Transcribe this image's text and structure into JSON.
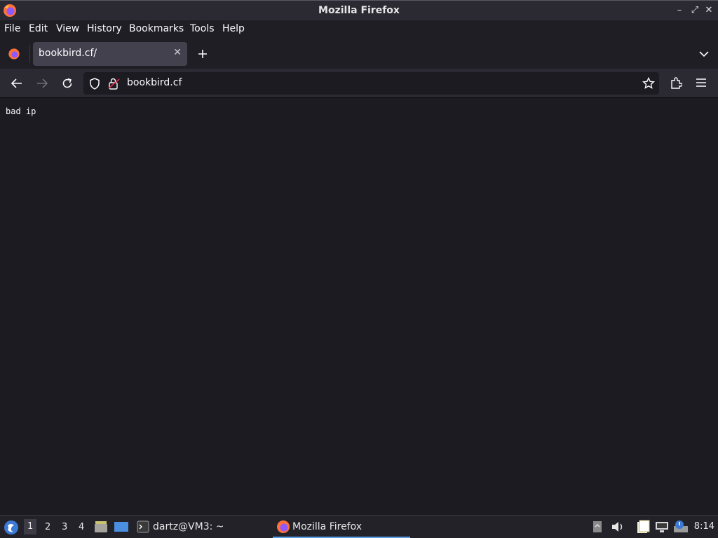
{
  "window": {
    "title": "Mozilla Firefox"
  },
  "menu": {
    "file": "File",
    "edit": "Edit",
    "view": "View",
    "history": "History",
    "bookmarks": "Bookmarks",
    "tools": "Tools",
    "help": "Help"
  },
  "tab": {
    "title": "bookbird.cf/"
  },
  "urlbar": {
    "url": "bookbird.cf"
  },
  "page": {
    "text": "bad ip"
  },
  "taskbar": {
    "workspaces": [
      "1",
      "2",
      "3",
      "4"
    ],
    "active_workspace": "1",
    "tasks": [
      {
        "label": "dartz@VM3: ~"
      },
      {
        "label": "Mozilla Firefox"
      }
    ],
    "clock": "8:14"
  },
  "colors": {
    "accent": "#5a9ee6",
    "firefox_orange": "#ff7139",
    "firefox_purple": "#9059ff"
  }
}
